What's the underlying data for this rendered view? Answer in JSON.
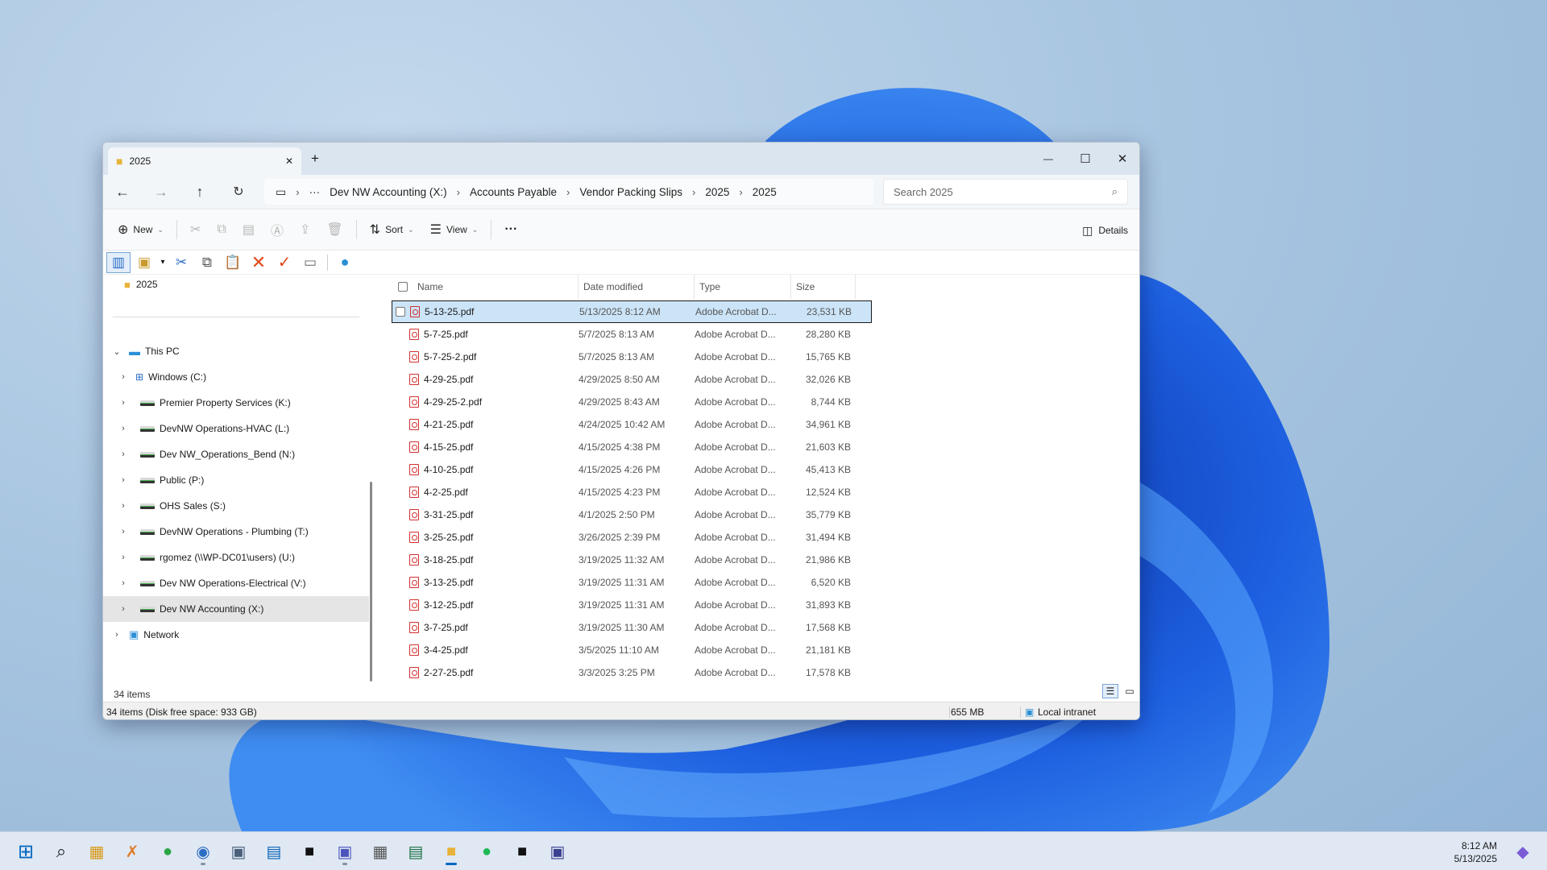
{
  "window": {
    "tab_title": "2025",
    "tab_close": "✕",
    "new_tab": "+",
    "controls": {
      "minimize": "—",
      "maximize": "☐",
      "close": "✕"
    }
  },
  "address": {
    "crumbs": [
      "Dev NW Accounting (X:)",
      "Accounts Payable",
      "Vendor Packing Slips",
      "2025",
      "2025"
    ],
    "overflow": "···",
    "search_placeholder": "Search 2025"
  },
  "commands": {
    "new": "New",
    "sort": "Sort",
    "view": "View",
    "more": "···",
    "details": "Details"
  },
  "nav": {
    "current_folder": "2025",
    "this_pc": "This PC",
    "drives": [
      "Windows (C:)",
      "Premier Property Services (K:)",
      "DevNW Operations-HVAC (L:)",
      "Dev NW_Operations_Bend (N:)",
      "Public (P:)",
      "OHS Sales (S:)",
      "DevNW Operations - Plumbing (T:)",
      "rgomez (\\\\WP-DC01\\users) (U:)",
      "Dev NW Operations-Electrical (V:)",
      "Dev NW Accounting (X:)"
    ],
    "selected_drive": "Dev NW Accounting (X:)",
    "network": "Network"
  },
  "files": {
    "columns": {
      "name": "Name",
      "date": "Date modified",
      "type": "Type",
      "size": "Size"
    },
    "rows": [
      {
        "name": "5-13-25.pdf",
        "date": "5/13/2025 8:12 AM",
        "type": "Adobe Acrobat D...",
        "size": "23,531 KB",
        "selected": true
      },
      {
        "name": "5-7-25.pdf",
        "date": "5/7/2025 8:13 AM",
        "type": "Adobe Acrobat D...",
        "size": "28,280 KB"
      },
      {
        "name": "5-7-25-2.pdf",
        "date": "5/7/2025 8:13 AM",
        "type": "Adobe Acrobat D...",
        "size": "15,765 KB"
      },
      {
        "name": "4-29-25.pdf",
        "date": "4/29/2025 8:50 AM",
        "type": "Adobe Acrobat D...",
        "size": "32,026 KB"
      },
      {
        "name": "4-29-25-2.pdf",
        "date": "4/29/2025 8:43 AM",
        "type": "Adobe Acrobat D...",
        "size": "8,744 KB"
      },
      {
        "name": "4-21-25.pdf",
        "date": "4/24/2025 10:42 AM",
        "type": "Adobe Acrobat D...",
        "size": "34,961 KB"
      },
      {
        "name": "4-15-25.pdf",
        "date": "4/15/2025 4:38 PM",
        "type": "Adobe Acrobat D...",
        "size": "21,603 KB"
      },
      {
        "name": "4-10-25.pdf",
        "date": "4/15/2025 4:26 PM",
        "type": "Adobe Acrobat D...",
        "size": "45,413 KB"
      },
      {
        "name": "4-2-25.pdf",
        "date": "4/15/2025 4:23 PM",
        "type": "Adobe Acrobat D...",
        "size": "12,524 KB"
      },
      {
        "name": "3-31-25.pdf",
        "date": "4/1/2025 2:50 PM",
        "type": "Adobe Acrobat D...",
        "size": "35,779 KB"
      },
      {
        "name": "3-25-25.pdf",
        "date": "3/26/2025 2:39 PM",
        "type": "Adobe Acrobat D...",
        "size": "31,494 KB"
      },
      {
        "name": "3-18-25.pdf",
        "date": "3/19/2025 11:32 AM",
        "type": "Adobe Acrobat D...",
        "size": "21,986 KB"
      },
      {
        "name": "3-13-25.pdf",
        "date": "3/19/2025 11:31 AM",
        "type": "Adobe Acrobat D...",
        "size": "6,520 KB"
      },
      {
        "name": "3-12-25.pdf",
        "date": "3/19/2025 11:31 AM",
        "type": "Adobe Acrobat D...",
        "size": "31,893 KB"
      },
      {
        "name": "3-7-25.pdf",
        "date": "3/19/2025 11:30 AM",
        "type": "Adobe Acrobat D...",
        "size": "17,568 KB"
      },
      {
        "name": "3-4-25.pdf",
        "date": "3/5/2025 11:10 AM",
        "type": "Adobe Acrobat D...",
        "size": "21,181 KB"
      },
      {
        "name": "2-27-25.pdf",
        "date": "3/3/2025 3:25 PM",
        "type": "Adobe Acrobat D...",
        "size": "17,578 KB"
      }
    ]
  },
  "footer": {
    "items_count": "34 items"
  },
  "status": {
    "left": "34 items (Disk free space: 933 GB)",
    "size": "655 MB",
    "zone": "Local intranet"
  },
  "clock": {
    "time": "8:12 AM",
    "date": "5/13/2025"
  },
  "colors": {
    "accent": "#0067c0",
    "selection": "#cce4f7",
    "pdf_red": "#d32f2f"
  }
}
